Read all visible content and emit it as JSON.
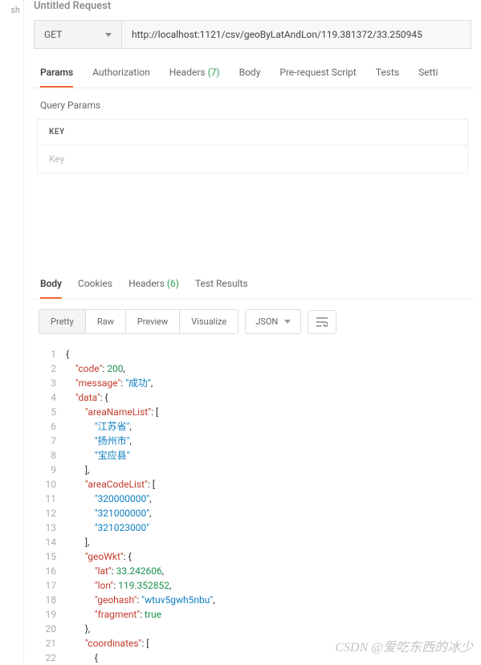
{
  "left_label": "sh",
  "request_title": "Untitled Request",
  "method": "GET",
  "url": "http://localhost:1121/csv/geoByLatAndLon/119.381372/33.250945",
  "tabs": {
    "params": "Params",
    "auth": "Authorization",
    "headers": "Headers",
    "headers_count": "(7)",
    "body": "Body",
    "prereq": "Pre-request Script",
    "tests": "Tests",
    "settings": "Setti"
  },
  "query_params_label": "Query Params",
  "key_header": "KEY",
  "key_placeholder": "Key",
  "resp_tabs": {
    "body": "Body",
    "cookies": "Cookies",
    "headers": "Headers",
    "headers_count": "(6)",
    "testresults": "Test Results"
  },
  "toolbar": {
    "pretty": "Pretty",
    "raw": "Raw",
    "preview": "Preview",
    "visualize": "Visualize",
    "fmt": "JSON"
  },
  "code_lines": [
    {
      "n": "1",
      "t": "punct",
      "c": "{"
    },
    {
      "n": "2",
      "parts": [
        {
          "t": "ind",
          "c": "    "
        },
        {
          "t": "key",
          "c": "\"code\""
        },
        {
          "t": "punct",
          "c": ": "
        },
        {
          "t": "num",
          "c": "200"
        },
        {
          "t": "punct",
          "c": ","
        }
      ]
    },
    {
      "n": "3",
      "parts": [
        {
          "t": "ind",
          "c": "    "
        },
        {
          "t": "key",
          "c": "\"message\""
        },
        {
          "t": "punct",
          "c": ": "
        },
        {
          "t": "str",
          "c": "\"成功\""
        },
        {
          "t": "punct",
          "c": ","
        }
      ]
    },
    {
      "n": "4",
      "parts": [
        {
          "t": "ind",
          "c": "    "
        },
        {
          "t": "key",
          "c": "\"data\""
        },
        {
          "t": "punct",
          "c": ": {"
        }
      ]
    },
    {
      "n": "5",
      "parts": [
        {
          "t": "ind",
          "c": "        "
        },
        {
          "t": "key",
          "c": "\"areaNameList\""
        },
        {
          "t": "punct",
          "c": ": ["
        }
      ]
    },
    {
      "n": "6",
      "parts": [
        {
          "t": "ind",
          "c": "            "
        },
        {
          "t": "str",
          "c": "\"江苏省\""
        },
        {
          "t": "punct",
          "c": ","
        }
      ]
    },
    {
      "n": "7",
      "parts": [
        {
          "t": "ind",
          "c": "            "
        },
        {
          "t": "str",
          "c": "\"扬州市\""
        },
        {
          "t": "punct",
          "c": ","
        }
      ]
    },
    {
      "n": "8",
      "parts": [
        {
          "t": "ind",
          "c": "            "
        },
        {
          "t": "str",
          "c": "\"宝应县\""
        }
      ]
    },
    {
      "n": "9",
      "parts": [
        {
          "t": "ind",
          "c": "        "
        },
        {
          "t": "punct",
          "c": "],"
        }
      ]
    },
    {
      "n": "10",
      "parts": [
        {
          "t": "ind",
          "c": "        "
        },
        {
          "t": "key",
          "c": "\"areaCodeList\""
        },
        {
          "t": "punct",
          "c": ": ["
        }
      ]
    },
    {
      "n": "11",
      "parts": [
        {
          "t": "ind",
          "c": "            "
        },
        {
          "t": "str",
          "c": "\"320000000\""
        },
        {
          "t": "punct",
          "c": ","
        }
      ]
    },
    {
      "n": "12",
      "parts": [
        {
          "t": "ind",
          "c": "            "
        },
        {
          "t": "str",
          "c": "\"321000000\""
        },
        {
          "t": "punct",
          "c": ","
        }
      ]
    },
    {
      "n": "13",
      "parts": [
        {
          "t": "ind",
          "c": "            "
        },
        {
          "t": "str",
          "c": "\"321023000\""
        }
      ]
    },
    {
      "n": "14",
      "parts": [
        {
          "t": "ind",
          "c": "        "
        },
        {
          "t": "punct",
          "c": "],"
        }
      ]
    },
    {
      "n": "15",
      "parts": [
        {
          "t": "ind",
          "c": "        "
        },
        {
          "t": "key",
          "c": "\"geoWkt\""
        },
        {
          "t": "punct",
          "c": ": {"
        }
      ]
    },
    {
      "n": "16",
      "parts": [
        {
          "t": "ind",
          "c": "            "
        },
        {
          "t": "key",
          "c": "\"lat\""
        },
        {
          "t": "punct",
          "c": ": "
        },
        {
          "t": "num",
          "c": "33.242606"
        },
        {
          "t": "punct",
          "c": ","
        }
      ]
    },
    {
      "n": "17",
      "parts": [
        {
          "t": "ind",
          "c": "            "
        },
        {
          "t": "key",
          "c": "\"lon\""
        },
        {
          "t": "punct",
          "c": ": "
        },
        {
          "t": "num",
          "c": "119.352852"
        },
        {
          "t": "punct",
          "c": ","
        }
      ]
    },
    {
      "n": "18",
      "parts": [
        {
          "t": "ind",
          "c": "            "
        },
        {
          "t": "key",
          "c": "\"geohash\""
        },
        {
          "t": "punct",
          "c": ": "
        },
        {
          "t": "str",
          "c": "\"wtuv5gwh5nbu\""
        },
        {
          "t": "punct",
          "c": ","
        }
      ]
    },
    {
      "n": "19",
      "parts": [
        {
          "t": "ind",
          "c": "            "
        },
        {
          "t": "key",
          "c": "\"fragment\""
        },
        {
          "t": "punct",
          "c": ": "
        },
        {
          "t": "bool",
          "c": "true"
        }
      ]
    },
    {
      "n": "20",
      "parts": [
        {
          "t": "ind",
          "c": "        "
        },
        {
          "t": "punct",
          "c": "},"
        }
      ]
    },
    {
      "n": "21",
      "parts": [
        {
          "t": "ind",
          "c": "        "
        },
        {
          "t": "key",
          "c": "\"coordinates\""
        },
        {
          "t": "punct",
          "c": ": ["
        }
      ]
    },
    {
      "n": "22",
      "parts": [
        {
          "t": "ind",
          "c": "            "
        },
        {
          "t": "punct",
          "c": "{"
        }
      ]
    }
  ],
  "watermark": "CSDN @爱吃东西的冰少"
}
